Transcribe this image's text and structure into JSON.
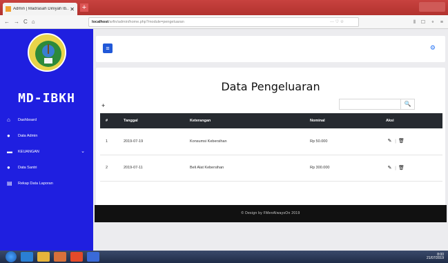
{
  "browser": {
    "tab_title": "Admin | Madrasah Diniyah Ib...",
    "tab_close": "✕",
    "new_tab": "+",
    "url_host": "localhost",
    "url_path": "/arfin/admin/home.php?module=pengeluaran",
    "nav_back": "←",
    "nav_forward": "→",
    "nav_reload": "C",
    "nav_home": "⌂",
    "url_actions": "··· ♡ ☆",
    "nav_right": "⦀ ☐ ⚬ ≡"
  },
  "sidebar": {
    "brand": "MD-IBKH",
    "items": [
      {
        "icon": "home-icon",
        "glyph": "⌂",
        "label": "Dashboard"
      },
      {
        "icon": "user-icon",
        "glyph": "●",
        "label": "Data Admin"
      },
      {
        "icon": "money-icon",
        "glyph": "▬",
        "label": "KEUANGAN",
        "chevron": "⌄"
      },
      {
        "icon": "user-icon",
        "glyph": "●",
        "label": "Data Santri"
      },
      {
        "icon": "report-icon",
        "glyph": "▤",
        "label": "Rekap Data Laporan"
      }
    ]
  },
  "topbar": {
    "menu_icon": "≡",
    "gear_icon": "⚙"
  },
  "content": {
    "title": "Data Pengeluaran",
    "add_icon": "+",
    "search_placeholder": "",
    "search_icon": "🔍",
    "columns": [
      "#",
      "Tanggal",
      "Keterangan",
      "Nominal",
      "Aksi"
    ],
    "rows": [
      {
        "no": "1",
        "tanggal": "2019-07-19",
        "keterangan": "Konsumsi Kebersihan",
        "nominal": "Rp 50.000"
      },
      {
        "no": "2",
        "tanggal": "2019-07-11",
        "keterangan": "Beli Alat Kebersihan",
        "nominal": "Rp 300.000"
      }
    ],
    "edit_icon": "✎",
    "delete_icon": "🗑",
    "action_sep": "|"
  },
  "footer": {
    "text": "© Design by FMenAlwaysOn 2019"
  },
  "taskbar": {
    "tray_time": "8:00",
    "tray_date": "21/07/2019"
  },
  "colors": {
    "sidebar_bg": "#1f1fe0",
    "table_header": "#262a30",
    "accent": "#2158d8"
  }
}
